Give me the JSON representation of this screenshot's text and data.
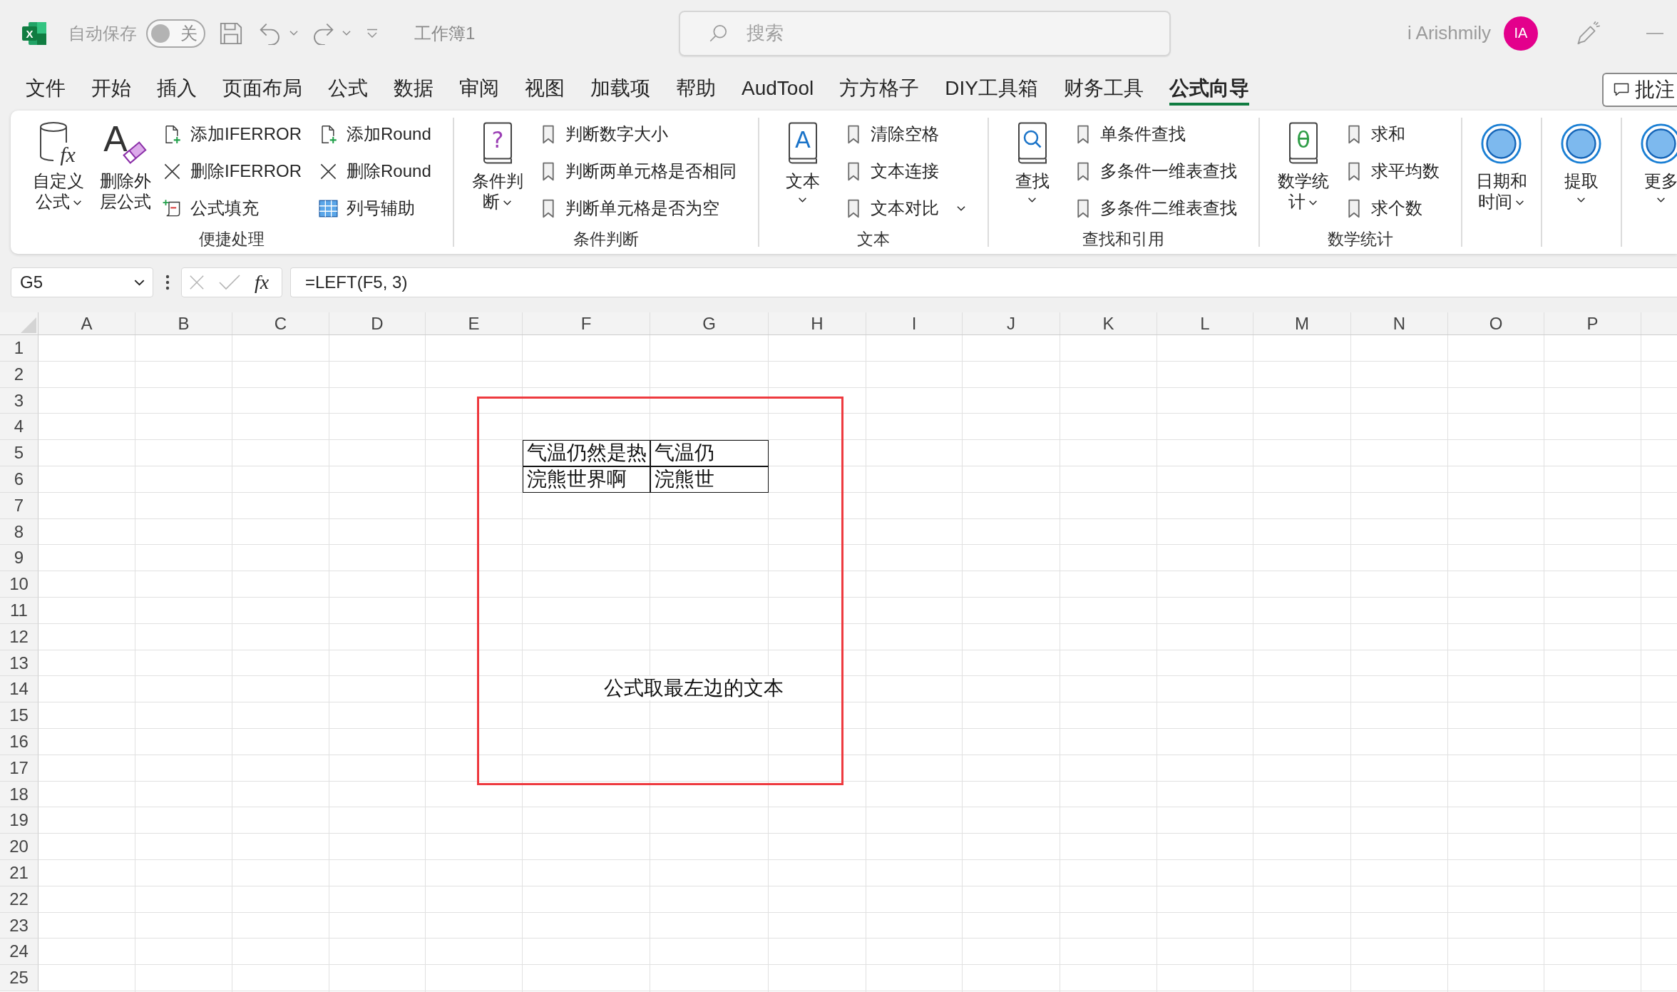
{
  "title_bar": {
    "app_icon_letter": "X",
    "autosave": {
      "label": "自动保存",
      "on": false,
      "toggle_text": "关"
    },
    "document_title": "工作簿1",
    "search": {
      "placeholder": "搜索"
    },
    "user": {
      "name": "i Arishmily",
      "initials": "IA"
    }
  },
  "tabs": [
    {
      "label": "文件",
      "selected": false
    },
    {
      "label": "开始",
      "selected": false
    },
    {
      "label": "插入",
      "selected": false
    },
    {
      "label": "页面布局",
      "selected": false
    },
    {
      "label": "公式",
      "selected": false
    },
    {
      "label": "数据",
      "selected": false
    },
    {
      "label": "审阅",
      "selected": false
    },
    {
      "label": "视图",
      "selected": false
    },
    {
      "label": "加载项",
      "selected": false
    },
    {
      "label": "帮助",
      "selected": false
    },
    {
      "label": "AudTool",
      "selected": false
    },
    {
      "label": "方方格子",
      "selected": false
    },
    {
      "label": "DIY工具箱",
      "selected": false
    },
    {
      "label": "财务工具",
      "selected": false
    },
    {
      "label": "公式向导",
      "selected": true
    }
  ],
  "comments_button": {
    "label": "批注"
  },
  "ribbon": {
    "groups": [
      {
        "label": "便捷处理",
        "large_buttons": [
          {
            "label": "自定义公式",
            "kind": "cylinder",
            "glyph": "fx",
            "dropdown": true
          },
          {
            "label": "删除外层公式",
            "kind": "eraser",
            "glyph": "A",
            "dropdown": false
          }
        ],
        "columns": [
          [
            {
              "label": "添加IFERROR",
              "kind": "add-document",
              "dropdown": false
            },
            {
              "label": "删除IFERROR",
              "kind": "cross",
              "dropdown": false
            },
            {
              "label": "公式填充",
              "kind": "scroll",
              "dropdown": false
            }
          ],
          [
            {
              "label": "添加Round",
              "kind": "add-document",
              "dropdown": false
            },
            {
              "label": "删除Round",
              "kind": "cross",
              "dropdown": false
            },
            {
              "label": "列号辅助",
              "kind": "grid",
              "dropdown": false
            }
          ]
        ]
      },
      {
        "label": "条件判断",
        "large_buttons": [
          {
            "label": "条件判断",
            "kind": "question-book",
            "glyph": "?",
            "dropdown": true
          }
        ],
        "columns": [
          [
            {
              "label": "判断数字大小",
              "kind": "bookmark",
              "dropdown": false
            },
            {
              "label": "判断两单元格是否相同",
              "kind": "bookmark",
              "dropdown": false
            },
            {
              "label": "判断单元格是否为空",
              "kind": "bookmark",
              "dropdown": false
            }
          ]
        ]
      },
      {
        "label": "文本",
        "large_buttons": [
          {
            "label": "文本",
            "kind": "letter-book",
            "glyph": "A",
            "dropdown": true
          }
        ],
        "columns": [
          [
            {
              "label": "清除空格",
              "kind": "bookmark",
              "dropdown": false
            },
            {
              "label": "文本连接",
              "kind": "bookmark",
              "dropdown": false
            },
            {
              "label": "文本对比",
              "kind": "bookmark",
              "dropdown": true
            }
          ]
        ]
      },
      {
        "label": "查找和引用",
        "large_buttons": [
          {
            "label": "查找",
            "kind": "search-book",
            "dropdown": true
          }
        ],
        "columns": [
          [
            {
              "label": "单条件查找",
              "kind": "bookmark",
              "dropdown": false
            },
            {
              "label": "多条件一维表查找",
              "kind": "bookmark",
              "dropdown": false
            },
            {
              "label": "多条件二维表查找",
              "kind": "bookmark",
              "dropdown": false
            }
          ]
        ]
      },
      {
        "label": "数学统计",
        "large_buttons": [
          {
            "label": "数学统计",
            "kind": "formula-book",
            "glyph": "θ",
            "dropdown": true
          }
        ],
        "columns": [
          [
            {
              "label": "求和",
              "kind": "bookmark",
              "dropdown": false
            },
            {
              "label": "求平均数",
              "kind": "bookmark",
              "dropdown": false
            },
            {
              "label": "求个数",
              "kind": "bookmark",
              "dropdown": false
            }
          ]
        ]
      },
      {
        "large_buttons": [
          {
            "label": "日期和时间",
            "kind": "ring",
            "dropdown": true
          }
        ]
      },
      {
        "large_buttons": [
          {
            "label": "提取",
            "kind": "ring",
            "dropdown": true
          }
        ]
      },
      {
        "large_buttons": [
          {
            "label": "更多",
            "kind": "ring",
            "dropdown": true
          }
        ]
      }
    ]
  },
  "formula_bar": {
    "name_box": "G5",
    "function_label": "fx",
    "formula": "=LEFT(F5, 3)"
  },
  "sheet": {
    "columns": [
      "A",
      "B",
      "C",
      "D",
      "E",
      "F",
      "G",
      "H",
      "I",
      "J",
      "K",
      "L",
      "M",
      "N",
      "O",
      "P"
    ],
    "rows": [
      {
        "number": "1"
      },
      {
        "number": "2"
      },
      {
        "number": "3"
      },
      {
        "number": "4"
      },
      {
        "number": "5",
        "cells": {
          "F": {
            "text": "气温仍然是热",
            "bordered": true
          },
          "G": {
            "text": "气温仍",
            "bordered": true
          }
        }
      },
      {
        "number": "6",
        "cells": {
          "F": {
            "text": "浣熊世界啊",
            "bordered": true
          },
          "G": {
            "text": "浣熊世",
            "bordered": true
          }
        }
      },
      {
        "number": "7"
      },
      {
        "number": "8"
      },
      {
        "number": "9"
      },
      {
        "number": "10"
      },
      {
        "number": "11"
      },
      {
        "number": "12"
      },
      {
        "number": "13"
      },
      {
        "number": "14",
        "cells": {
          "F": {
            "text": "公式取最左边的文本",
            "bordered": false
          }
        }
      },
      {
        "number": "15"
      },
      {
        "number": "16"
      },
      {
        "number": "17"
      },
      {
        "number": "18"
      },
      {
        "number": "19"
      },
      {
        "number": "20"
      },
      {
        "number": "21"
      },
      {
        "number": "22"
      },
      {
        "number": "23"
      },
      {
        "number": "24"
      },
      {
        "number": "25"
      }
    ]
  },
  "annotations": [
    {
      "kind": "rectangle"
    }
  ]
}
